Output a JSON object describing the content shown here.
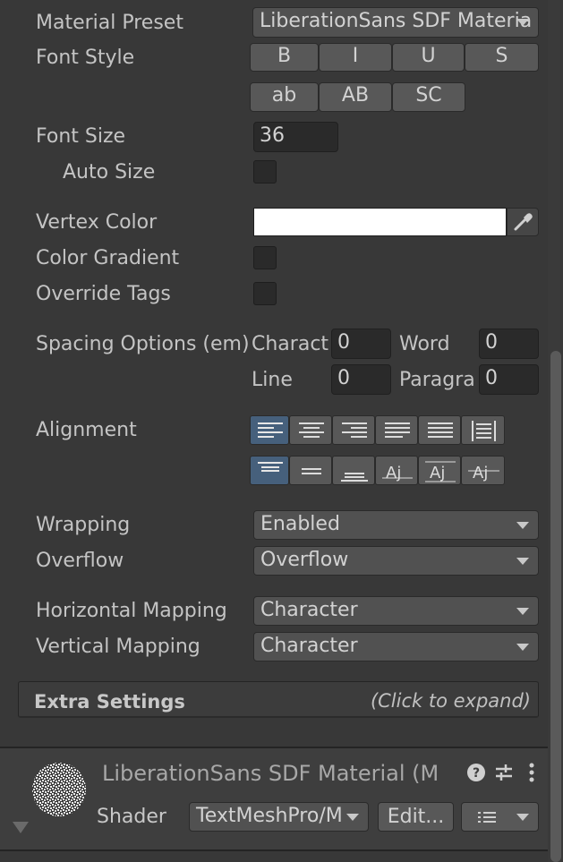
{
  "material_preset": {
    "label": "Material Preset",
    "value": "LiberationSans SDF Materia"
  },
  "font_style": {
    "label": "Font Style",
    "row1": [
      "B",
      "I",
      "U",
      "S"
    ],
    "row2": [
      "ab",
      "AB",
      "SC"
    ]
  },
  "font_size": {
    "label": "Font Size",
    "value": "36"
  },
  "auto_size": {
    "label": "Auto Size"
  },
  "vertex_color": {
    "label": "Vertex Color",
    "color": "#ffffff"
  },
  "color_gradient": {
    "label": "Color Gradient"
  },
  "override_tags": {
    "label": "Override Tags"
  },
  "spacing": {
    "label": "Spacing Options (em)",
    "character_label": "Charact",
    "character_value": "0",
    "word_label": "Word",
    "word_value": "0",
    "line_label": "Line",
    "line_value": "0",
    "paragraph_label": "Paragra",
    "paragraph_value": "0"
  },
  "alignment": {
    "label": "Alignment",
    "horizontal_icons": [
      "align-left-icon",
      "align-center-icon",
      "align-right-icon",
      "align-justified-icon",
      "align-flush-icon",
      "align-geometry-center-icon"
    ],
    "vertical_icons": [
      "align-top-icon",
      "align-middle-icon",
      "align-bottom-icon",
      "align-baseline-icon",
      "align-midline-icon",
      "align-capline-icon"
    ],
    "horizontal_selected": "align-left-icon",
    "vertical_selected": "align-top-icon"
  },
  "wrapping": {
    "label": "Wrapping",
    "value": "Enabled"
  },
  "overflow": {
    "label": "Overflow",
    "value": "Overflow"
  },
  "horizontal_mapping": {
    "label": "Horizontal Mapping",
    "value": "Character"
  },
  "vertical_mapping": {
    "label": "Vertical Mapping",
    "value": "Character"
  },
  "extra_settings": {
    "title": "Extra Settings",
    "hint": "(Click to expand)"
  },
  "material_component": {
    "title": "LiberationSans SDF Material (M",
    "shader_label": "Shader",
    "shader_value": "TextMeshPro/M",
    "edit_label": "Edit..."
  },
  "colors": {
    "background": "#383838",
    "selected": "#46607c",
    "field": "#2a2a2a",
    "button": "#585858"
  }
}
